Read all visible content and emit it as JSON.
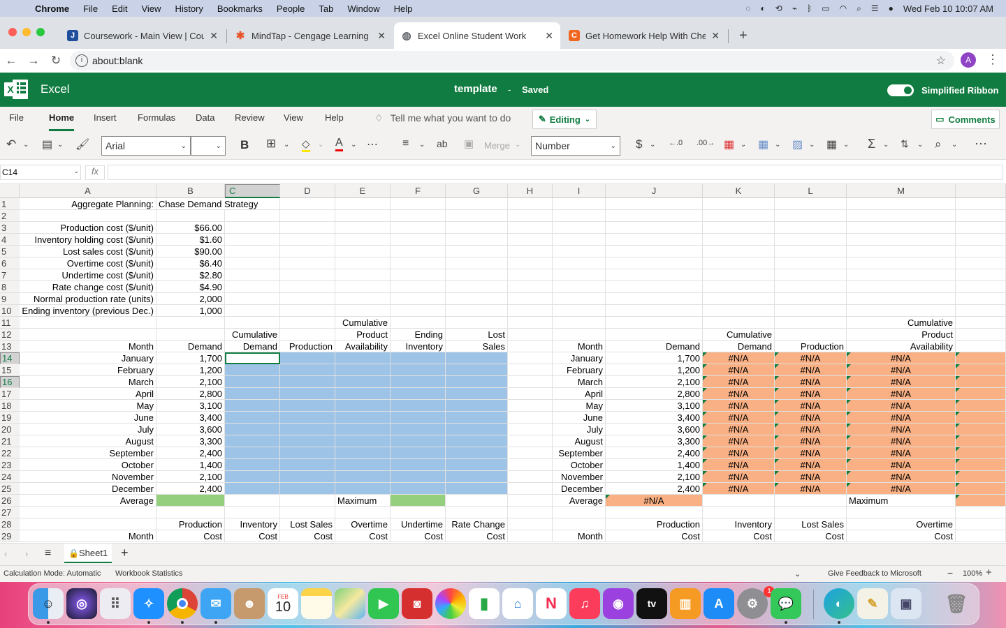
{
  "menubar": {
    "app": "Chrome",
    "items": [
      "File",
      "Edit",
      "View",
      "History",
      "Bookmarks",
      "People",
      "Tab",
      "Window",
      "Help"
    ],
    "datetime": "Wed Feb 10  10:07 AM"
  },
  "tabs": [
    {
      "title": "Coursework - Main View | Cour",
      "fav": "J",
      "color": "#1f4e9c"
    },
    {
      "title": "MindTap - Cengage Learning",
      "fav": "✱",
      "color": "#e8542c"
    },
    {
      "title": "Excel Online Student Work",
      "fav": "◍",
      "color": "#5f6368"
    },
    {
      "title": "Get Homework Help With Cheg",
      "fav": "C",
      "color": "#f06721"
    }
  ],
  "address": {
    "url": "about:blank",
    "avatar": "A"
  },
  "excel": {
    "app": "Excel",
    "doc": "template",
    "dash": "-",
    "saved": "Saved",
    "simplified": "Simplified Ribbon",
    "ribbon_tabs": [
      "File",
      "Home",
      "Insert",
      "Formulas",
      "Data",
      "Review",
      "View",
      "Help"
    ],
    "tell_me": "Tell me what you want to do",
    "editing": "Editing",
    "comments": "Comments",
    "font": "Arial",
    "merge": "Merge",
    "number_format": "Number",
    "name_box": "C14",
    "fx": "fx"
  },
  "columns": [
    "A",
    "B",
    "C",
    "D",
    "E",
    "F",
    "G",
    "H",
    "I",
    "J",
    "K",
    "L",
    "M"
  ],
  "rows": [
    1,
    2,
    3,
    4,
    5,
    6,
    7,
    8,
    9,
    10,
    11,
    12,
    13,
    14,
    15,
    16,
    17,
    18,
    19,
    20,
    21,
    22,
    23,
    24,
    25,
    26,
    27,
    28,
    29
  ],
  "sheet": {
    "A1": "Aggregate Planning:",
    "B1": "Chase Demand Strategy",
    "A3": "Production cost ($/unit)",
    "B3": "$66.00",
    "A4": "Inventory holding cost ($/unit)",
    "B4": "$1.60",
    "A5": "Lost sales cost ($/unit)",
    "B5": "$90.00",
    "A6": "Overtime cost ($/unit)",
    "B6": "$6.40",
    "A7": "Undertime cost ($/unit)",
    "B7": "$2.80",
    "A8": "Rate change cost ($/unit)",
    "B8": "$4.90",
    "A9": "Normal production rate (units)",
    "B9": "2,000",
    "A10": "Ending inventory (previous Dec.)",
    "B10": "1,000",
    "E11": "Cumulative",
    "C12": "Cumulative",
    "E12": "Product",
    "F12": "Ending",
    "G12": "Lost",
    "A13": "Month",
    "B13": "Demand",
    "C13": "Demand",
    "D13": "Production",
    "E13": "Availability",
    "F13": "Inventory",
    "G13": "Sales",
    "A26": "Average",
    "E26": "Maximum",
    "B28": "Production",
    "C28": "Inventory",
    "D28": "Lost Sales",
    "E28": "Overtime",
    "F28": "Undertime",
    "G28": "Rate Change",
    "A29": "Month",
    "B29": "Cost",
    "C29": "Cost",
    "D29": "Cost",
    "E29": "Cost",
    "F29": "Cost",
    "G29": "Cost",
    "M11": "Cumulative",
    "K12": "Cumulative",
    "M12": "Product",
    "I13": "Month",
    "J13": "Demand",
    "K13": "Demand",
    "L13": "Production",
    "M13": "Availability",
    "I26": "Average",
    "J26": "#N/A",
    "M26": "Maximum",
    "J28": "Production",
    "K28": "Inventory",
    "L28": "Lost Sales",
    "M28": "Overtime",
    "I29": "Month",
    "J29": "Cost",
    "K29": "Cost",
    "L29": "Cost",
    "M29": "Cost"
  },
  "months": [
    "January",
    "February",
    "March",
    "April",
    "May",
    "June",
    "July",
    "August",
    "September",
    "October",
    "November",
    "December"
  ],
  "demand": [
    "1,700",
    "1,200",
    "2,100",
    "2,800",
    "3,100",
    "3,400",
    "3,600",
    "3,300",
    "2,400",
    "1,400",
    "2,100",
    "2,400"
  ],
  "na": "#N/A",
  "sheet_tab": "Sheet1",
  "status": {
    "calc": "Calculation Mode: Automatic",
    "stats": "Workbook Statistics",
    "feedback": "Give Feedback to Microsoft",
    "zoom": "100%"
  },
  "dock": {
    "calendar_month": "FEB",
    "calendar_day": "10",
    "badge": "1",
    "tv_label": "tv"
  }
}
